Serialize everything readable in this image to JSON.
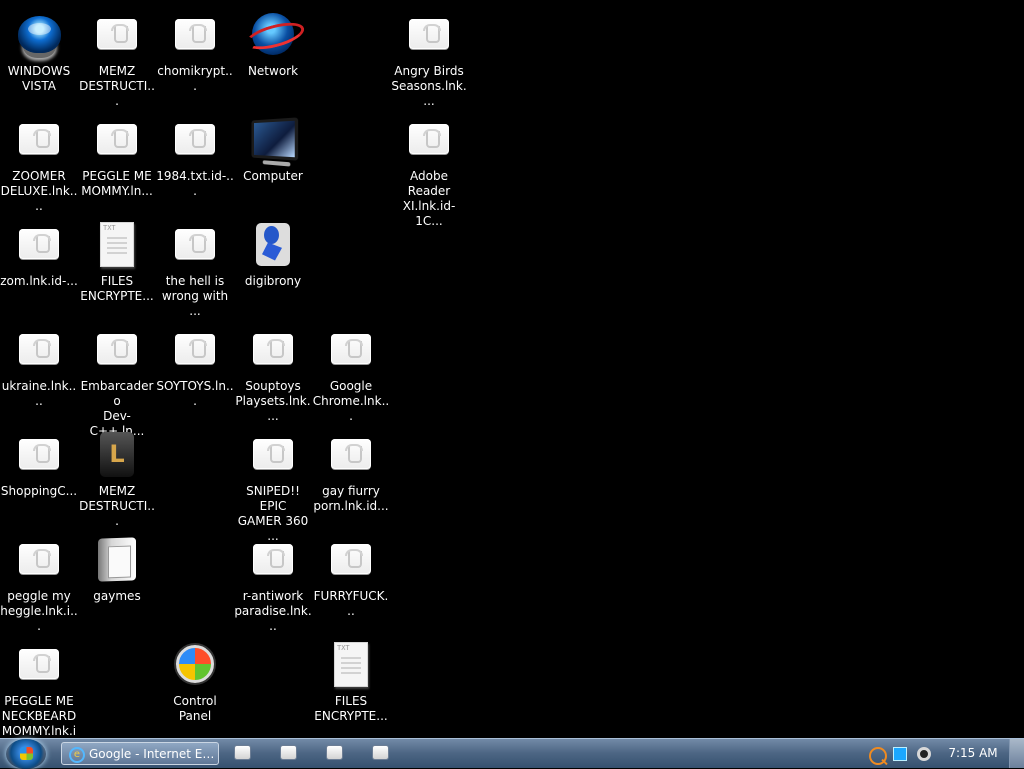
{
  "desktop": {
    "items": [
      {
        "label": "WINDOWS\nVISTA",
        "icon": "vista-orb-icon"
      },
      {
        "label": "MEMZ\nDESTRUCTI...",
        "icon": "generic-file-icon"
      },
      {
        "label": "chomikrypt...",
        "icon": "generic-file-icon"
      },
      {
        "label": "Network",
        "icon": "network-icon"
      },
      {
        "label": "Angry Birds\nSeasons.lnk....",
        "icon": "generic-file-icon"
      },
      {
        "label": "ZOOMER\nDELUXE.lnk....",
        "icon": "generic-file-icon"
      },
      {
        "label": "PEGGLE ME\nMOMMY.ln...",
        "icon": "generic-file-icon"
      },
      {
        "label": "1984.txt.id-...",
        "icon": "generic-file-icon"
      },
      {
        "label": "Computer",
        "icon": "computer-icon"
      },
      {
        "label": "Adobe Reader\nXI.lnk.id-1C...",
        "icon": "generic-file-icon"
      },
      {
        "label": "zom.lnk.id-...",
        "icon": "generic-file-icon"
      },
      {
        "label": "FILES\nENCRYPTE...",
        "icon": "text-file-icon",
        "tag": "TXT"
      },
      {
        "label": "the hell is\nwrong with ...",
        "icon": "generic-file-icon"
      },
      {
        "label": "digibrony",
        "icon": "digibrony-icon"
      },
      {
        "label": "ukraine.lnk....",
        "icon": "generic-file-icon"
      },
      {
        "label": "Embarcadero\nDev-C++.ln...",
        "icon": "generic-file-icon"
      },
      {
        "label": "SOYTOYS.ln...",
        "icon": "generic-file-icon"
      },
      {
        "label": "Souptoys\nPlaysets.lnk....",
        "icon": "generic-file-icon"
      },
      {
        "label": "Google\nChrome.lnk...",
        "icon": "generic-file-icon"
      },
      {
        "label": "ShoppingC...",
        "icon": "generic-file-icon"
      },
      {
        "label": "MEMZ\nDESTRUCTI...",
        "icon": "memz-icon"
      },
      {
        "label": "SNIPED!! EPIC\nGAMER 360 ...",
        "icon": "generic-file-icon"
      },
      {
        "label": "gay fiurry\nporn.lnk.id...",
        "icon": "generic-file-icon"
      },
      {
        "label": "peggle my\nheggle.lnk.i...",
        "icon": "generic-file-icon"
      },
      {
        "label": "gaymes",
        "icon": "folder-icon"
      },
      {
        "label": "r-antiwork\nparadise.lnk...",
        "icon": "generic-file-icon"
      },
      {
        "label": "FURRYFUCK...",
        "icon": "generic-file-icon"
      },
      {
        "label": "PEGGLE ME\nNECKBEARD\nMOMMY.lnk.i",
        "icon": "generic-file-icon"
      },
      {
        "label": "Control Panel",
        "icon": "control-panel-icon"
      },
      {
        "label": "FILES\nENCRYPTE...",
        "icon": "text-file-icon",
        "tag": "TXT"
      }
    ]
  },
  "taskbar": {
    "active_window": "Google - Internet Exp...",
    "clock": "7:15 AM",
    "quick_launch": [
      {
        "icon": "window-icon"
      },
      {
        "icon": "window-icon"
      },
      {
        "icon": "window-icon"
      },
      {
        "icon": "window-icon"
      }
    ]
  },
  "colors": {
    "desktop_background": "#000000",
    "taskbar_accent": "#4d6684",
    "text": "#ffffff"
  }
}
